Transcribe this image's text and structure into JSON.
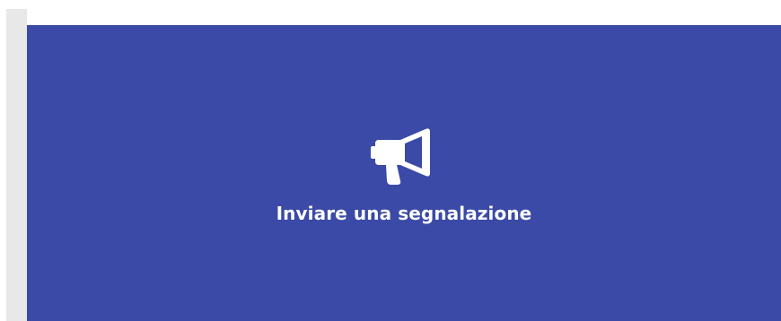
{
  "report_card": {
    "icon": "megaphone-icon",
    "label": "Inviare una segnalazione",
    "background_color": "#3a4aa6",
    "text_color": "#ffffff"
  }
}
